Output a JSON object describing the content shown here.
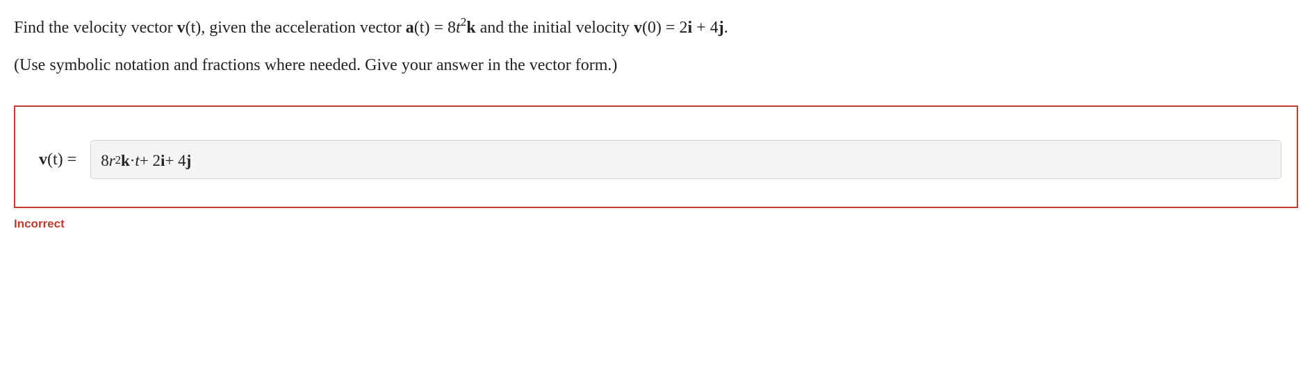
{
  "problem": {
    "find_1": "Find the velocity vector ",
    "vt": "v",
    "vt_t": "(t)",
    "given": ", given the acceleration vector ",
    "at": "a",
    "at_t": "(t)",
    "eq1": " = 8",
    "tvar": "t",
    "exp2": "2",
    "k": "k",
    "and_txt": " and the initial velocity ",
    "v0": "v",
    "v0_arg": "(0)",
    "eq2": " = 2",
    "i": "i",
    "plus": " + 4",
    "j": "j",
    "period": "."
  },
  "hint": "(Use symbolic notation and fractions where needed. Give your answer in the vector form.)",
  "answer": {
    "lhs_v": "v",
    "lhs_arg": "(t)",
    "lhs_eq": " =",
    "user_input_parts": {
      "p1": "8",
      "rv": "r",
      "exp": "2",
      "k": "k",
      "dot": " · ",
      "t": "t",
      "plus1": " + 2",
      "i": "i",
      "plus2": " + 4",
      "j": "j"
    }
  },
  "feedback": "Incorrect"
}
